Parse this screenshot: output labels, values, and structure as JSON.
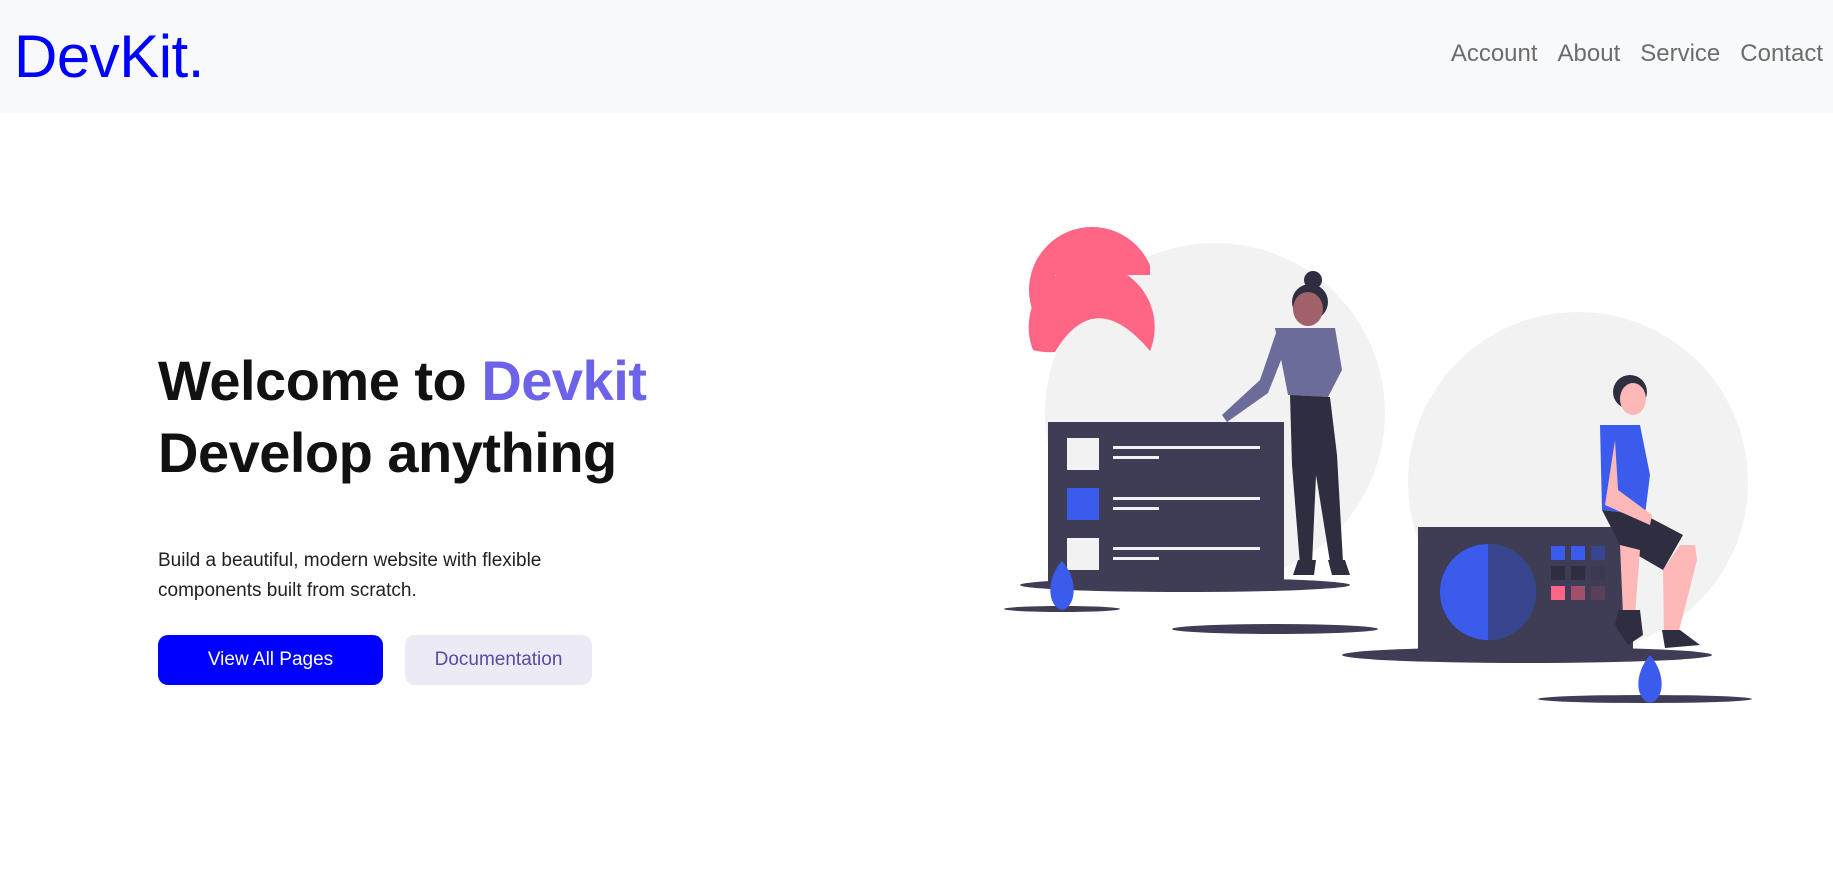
{
  "navbar": {
    "brand": "DevKit.",
    "links": [
      "Account",
      "About",
      "Service",
      "Contact"
    ]
  },
  "hero": {
    "headline_part1": "Welcome to ",
    "headline_accent": "Devkit",
    "headline_line2": "Develop anything",
    "lead": "Build a beautiful, modern website with flexible components built from scratch.",
    "primary_button": "View All Pages",
    "secondary_button": "Documentation"
  },
  "colors": {
    "brand": "#0000ff",
    "accent": "#6c63e8",
    "navbar_bg": "#f8f9fa",
    "primary_button_bg": "#0000ff",
    "secondary_button_bg": "#eceaf5"
  },
  "illustration": {
    "name": "team-working-illustration"
  }
}
